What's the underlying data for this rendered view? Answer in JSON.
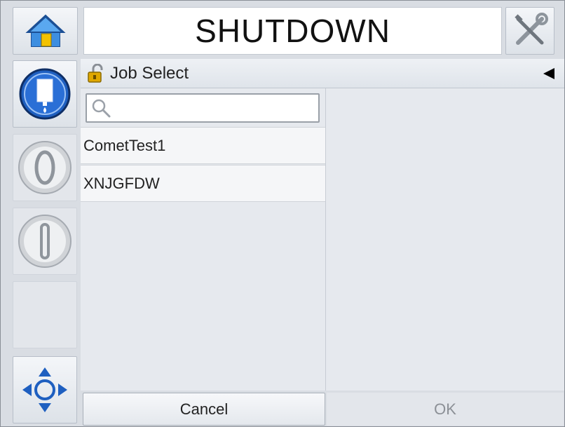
{
  "header": {
    "title": "SHUTDOWN",
    "home_icon": "home-icon",
    "tools_icon": "tools-icon"
  },
  "sidebar": {
    "items": [
      {
        "icon": "ink-cartridge-icon",
        "state": "active"
      },
      {
        "icon": "jet-start-icon",
        "state": "inactive"
      },
      {
        "icon": "jet-stop-icon",
        "state": "inactive"
      },
      {
        "icon": "empty-slot",
        "state": "inactive"
      },
      {
        "icon": "navigation-arrows-icon",
        "state": "active"
      }
    ]
  },
  "panel": {
    "title": "Job Select",
    "lock_icon": "unlocked-padlock-icon",
    "collapse_icon": "triangle-left-icon"
  },
  "search": {
    "value": "",
    "icon": "search-icon"
  },
  "jobs": [
    {
      "name": "CometTest1"
    },
    {
      "name": "XNJGFDW"
    }
  ],
  "footer": {
    "cancel_label": "Cancel",
    "ok_label": "OK"
  },
  "colors": {
    "accent_blue": "#1e5fc0",
    "disabled_text": "#8c9096"
  }
}
